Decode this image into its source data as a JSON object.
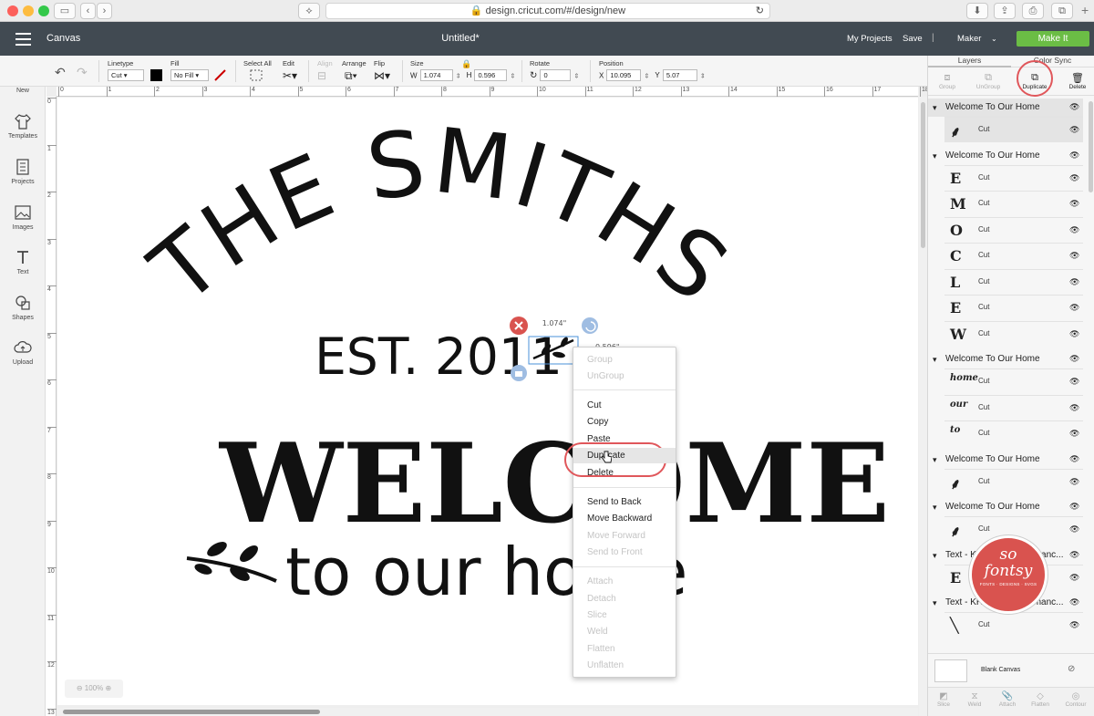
{
  "browser": {
    "url": "design.cricut.com/#/design/new",
    "lights": [
      "#fc605b",
      "#fdbc40",
      "#34c84a"
    ]
  },
  "header": {
    "canvas_label": "Canvas",
    "project_title": "Untitled*",
    "my_projects": "My Projects",
    "save": "Save",
    "divider": "|",
    "machine": "Maker",
    "make_it": "Make It",
    "make_it_color": "#6bbd45",
    "bar_color": "#414a52"
  },
  "toolbar": {
    "linetype_label": "Linetype",
    "linetype_value": "Cut",
    "fill_label": "Fill",
    "fill_value": "No Fill",
    "select_all": "Select All",
    "edit": "Edit",
    "align": "Align",
    "arrange": "Arrange",
    "flip": "Flip",
    "size_label": "Size",
    "w_label": "W",
    "w_value": "1.074",
    "h_label": "H",
    "h_value": "0.596",
    "rotate_label": "Rotate",
    "rotate_value": "0",
    "position_label": "Position",
    "x_label": "X",
    "x_value": "10.095",
    "y_label": "Y",
    "y_value": "5.07"
  },
  "left_nav": [
    "New",
    "Templates",
    "Projects",
    "Images",
    "Text",
    "Shapes",
    "Upload"
  ],
  "ruler": {
    "top": [
      "0",
      "1",
      "2",
      "3",
      "4",
      "5",
      "6",
      "7",
      "8",
      "9",
      "10",
      "11",
      "12",
      "13",
      "14",
      "15",
      "16",
      "17",
      "18"
    ],
    "left": [
      "0",
      "1",
      "2",
      "3",
      "4",
      "5",
      "6",
      "7",
      "8",
      "9",
      "10",
      "11",
      "12",
      "13"
    ]
  },
  "design": {
    "line1": "THE SMITHS",
    "line2": "EST. 2011",
    "line3": "WELCOME",
    "line4": "to our home"
  },
  "selection": {
    "width_label": "1.074\"",
    "height_label": "0.596\""
  },
  "zoom": "100%",
  "context_menu": [
    {
      "label": "Group",
      "enabled": false
    },
    {
      "label": "UnGroup",
      "enabled": false
    },
    {
      "label": "Cut",
      "enabled": true
    },
    {
      "label": "Copy",
      "enabled": true
    },
    {
      "label": "Paste",
      "enabled": true
    },
    {
      "label": "Duplicate",
      "enabled": true,
      "highlighted": true
    },
    {
      "label": "Delete",
      "enabled": true
    },
    {
      "label": "Send to Back",
      "enabled": true
    },
    {
      "label": "Move Backward",
      "enabled": true
    },
    {
      "label": "Move Forward",
      "enabled": false
    },
    {
      "label": "Send to Front",
      "enabled": false
    },
    {
      "label": "Attach",
      "enabled": false
    },
    {
      "label": "Detach",
      "enabled": false
    },
    {
      "label": "Slice",
      "enabled": false
    },
    {
      "label": "Weld",
      "enabled": false
    },
    {
      "label": "Flatten",
      "enabled": false
    },
    {
      "label": "Unflatten",
      "enabled": false
    }
  ],
  "panel": {
    "tabs": [
      "Layers",
      "Color Sync"
    ],
    "actions": [
      "Group",
      "UnGroup",
      "Duplicate",
      "Delete"
    ],
    "groups": [
      {
        "name": "Welcome To Our Home",
        "layers": [
          {
            "label": "Cut",
            "thumb": "branch"
          }
        ]
      },
      {
        "name": "Welcome To Our Home",
        "layers": [
          {
            "label": "Cut",
            "thumb": "E"
          },
          {
            "label": "Cut",
            "thumb": "M"
          },
          {
            "label": "Cut",
            "thumb": "O"
          },
          {
            "label": "Cut",
            "thumb": "C"
          },
          {
            "label": "Cut",
            "thumb": "L"
          },
          {
            "label": "Cut",
            "thumb": "E"
          },
          {
            "label": "Cut",
            "thumb": "W"
          }
        ]
      },
      {
        "name": "Welcome To Our Home",
        "layers": [
          {
            "label": "Cut",
            "thumb": "home"
          },
          {
            "label": "Cut",
            "thumb": "our"
          },
          {
            "label": "Cut",
            "thumb": "to"
          }
        ]
      },
      {
        "name": "Welcome To Our Home",
        "layers": [
          {
            "label": "Cut",
            "thumb": "branch"
          }
        ]
      },
      {
        "name": "Welcome To Our Home",
        "layers": [
          {
            "label": "Cut",
            "thumb": "branch"
          }
        ]
      },
      {
        "name": "Text - KH-Delicate-Romanc...",
        "layers": [
          {
            "label": "Cut",
            "thumb": "E"
          }
        ]
      },
      {
        "name": "Text - KH-Delicate-Romanc...",
        "layers": [
          {
            "label": "Cut",
            "thumb": "/"
          }
        ]
      }
    ],
    "blank_canvas": "Blank Canvas",
    "bottom": [
      "Slice",
      "Weld",
      "Attach",
      "Flatten",
      "Contour"
    ]
  },
  "watermark": {
    "line1": "so",
    "line2": "fontsy",
    "line3": "FONTS · DESIGNS · SVGS",
    "color": "#d9534f"
  },
  "highlight_color": "#e0575b"
}
